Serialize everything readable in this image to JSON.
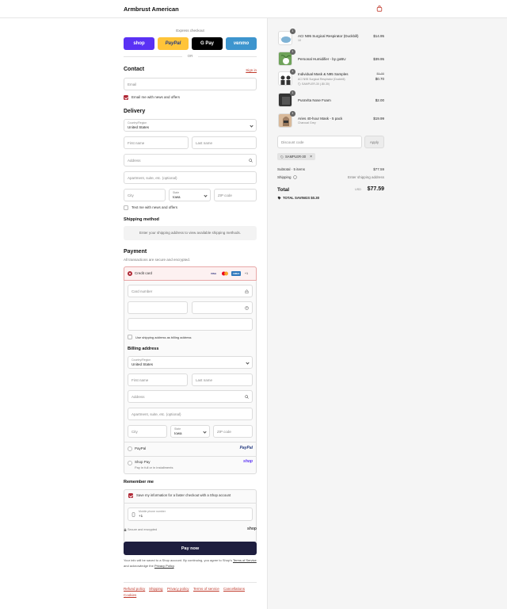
{
  "header": {
    "brand": "Armbrust American",
    "cart_icon": "shopping-bag-icon",
    "accent": "#c0392b"
  },
  "express": {
    "label": "Express checkout",
    "buttons": [
      {
        "label": "shop",
        "bg": "#5a31f4",
        "color": "#ffffff"
      },
      {
        "label": "PayPal",
        "bg": "#ffc439",
        "color": "#253b80"
      },
      {
        "label": "G Pay",
        "bg": "#000000",
        "color": "#ffffff"
      },
      {
        "label": "venmo",
        "bg": "#3d95ce",
        "color": "#ffffff"
      }
    ],
    "or": "OR"
  },
  "contact": {
    "title": "Contact",
    "sign_in": "Sign in",
    "email_placeholder": "Email",
    "news_label": "Email me with news and offers"
  },
  "delivery": {
    "title": "Delivery",
    "country_label": "Country/Region",
    "country_value": "United States",
    "first_name": "First name",
    "last_name": "Last name",
    "address": "Address",
    "apartment": "Apartment, suite, etc. (optional)",
    "city": "City",
    "state_label": "State",
    "state_value": "Iowa",
    "zip": "ZIP code",
    "text_label": "Text me with news and offers"
  },
  "shipping": {
    "title": "Shipping method",
    "placeholder": "Enter your shipping address to view available shipping methods."
  },
  "payment": {
    "title": "Payment",
    "subtitle": "All transactions are secure and encrypted.",
    "credit_card": "Credit card",
    "card_logos": [
      "VISA",
      "MC",
      "AMEX",
      "+1"
    ],
    "card_number": "Card number",
    "use_shipping": "Use shipping address as billing address",
    "billing_title": "Billing address",
    "country_label": "Country/Region",
    "country_value": "United States",
    "first_name": "First name",
    "last_name": "Last name",
    "address": "Address",
    "apartment": "Apartment, suite, etc. (optional)",
    "city": "City",
    "state_label": "State",
    "state_value": "Iowa",
    "zip": "ZIP code",
    "paypal": "PayPal",
    "paypal_logo": "PayPal",
    "shoppay": "Shop Pay",
    "shoppay_sub": "Pay in full or in installments",
    "shoppay_logo": "shop"
  },
  "remember": {
    "title": "Remember me",
    "save_label": "Save my information for a faster checkout with a Shop account",
    "phone_label": "Mobile phone number",
    "phone_value": "+1",
    "secure": "Secure and encrypted",
    "shop_logo": "shop"
  },
  "pay_now": "Pay now",
  "legal": {
    "text1": "Your info will be saved to a Shop account. By continuing, you agree to Shop's",
    "terms": "Terms of Service",
    "text2": "and acknowledge the",
    "privacy": "Privacy Policy",
    "period": "."
  },
  "footer": {
    "links": [
      "Refund policy",
      "Shipping",
      "Privacy policy",
      "Terms of service",
      "Cancellations",
      "Cookies"
    ]
  },
  "cart": {
    "items": [
      {
        "qty": "1",
        "name": "ACI N95 Surgical Respirator (Duckbill)",
        "sub": "10",
        "price": "$14.95",
        "thumb": "mask-icon"
      },
      {
        "qty": "1",
        "name": "Personal Humidifier - by goBU",
        "sub": "",
        "price": "$39.95",
        "thumb": "plant-icon"
      },
      {
        "qty": "1",
        "name": "Individual Mask & N95 Samples",
        "sub": "ACI N95 Surgical Respirator (Duckbill)",
        "sub2": "SAMPLER-30 (-$0.30)",
        "old_price": "$1.00",
        "price": "$0.70",
        "thumb": "people-icon"
      },
      {
        "qty": "1",
        "name": "PuraVita Nose Foam",
        "sub": "",
        "price": "$2.00",
        "thumb": "foam-icon"
      },
      {
        "qty": "1",
        "name": "Aries 40-hour Mask - 5 pack",
        "sub": "Charcoal Grey",
        "price": "$19.99",
        "thumb": "woman-icon"
      }
    ],
    "discount_placeholder": "Discount code",
    "apply": "Apply",
    "code_tag": "SAMPLER-30",
    "subtotal_label": "Subtotal · 5 items",
    "subtotal_value": "$77.59",
    "shipping_label": "Shipping",
    "shipping_value": "Enter shipping address",
    "total_label": "Total",
    "currency": "USD",
    "total_value": "$77.59",
    "savings_label": "TOTAL SAVINGS",
    "savings_value": "$0.30"
  }
}
